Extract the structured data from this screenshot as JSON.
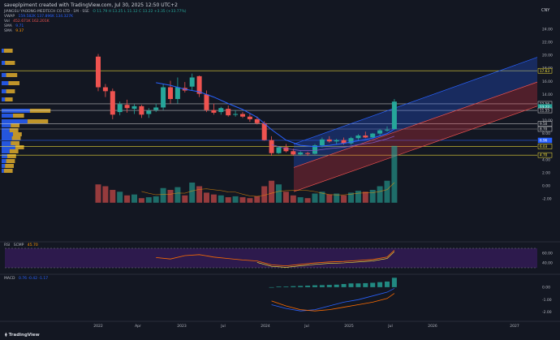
{
  "header": {
    "title": "saveplpiment created with TradingView.com, Jul 30, 2025 12:50 UTC+2",
    "currency": "CNY"
  },
  "legend": {
    "symbol_line": "JIANGSU YAODNG-MEDTECH CO LTD · 1M · SSE",
    "ohlc": "O 11.79  H 13.25  L 11.12  C 13.22  +3.35 (+33.77%)",
    "vwap_label": "VWAP",
    "vwap_values": "159.582K  137.896K  134.327K",
    "vol_label": "Vol",
    "vol_values": "452.671K  162.201K",
    "sma1_label": "SMA",
    "sma1_value": "9.71",
    "sma2_label": "SMA",
    "sma2_value": "9.37"
  },
  "price_axis": {
    "ticks": [
      "24.00",
      "22.00",
      "20.00",
      "18.00",
      "16.00",
      "14.00",
      "12.00",
      "10.00",
      "8.00",
      "6.00",
      "4.00",
      "2.00",
      "0.00",
      "-2.00"
    ]
  },
  "price_tags": [
    {
      "label": "17.63",
      "bg": "#131722",
      "fg": "#ffeb3b",
      "border": "#ffeb3b",
      "value": 17.63
    },
    {
      "label": "12.56",
      "bg": "#131722",
      "fg": "#e0e0e0",
      "border": "#e0e0e0",
      "value": 12.56
    },
    {
      "label": "13.22",
      "bg": "#26a69a",
      "fg": "#ffffff",
      "border": "#26a69a",
      "value": 12.1
    },
    {
      "label": "11.55",
      "bg": "#131722",
      "fg": "#e0e0e0",
      "border": "#e0e0e0",
      "value": 11.55
    },
    {
      "label": "9.50",
      "bg": "#131722",
      "fg": "#e0e0e0",
      "border": "#e0e0e0",
      "value": 9.5
    },
    {
      "label": "8.70",
      "bg": "#131722",
      "fg": "#e0e0e0",
      "border": "#e0e0e0",
      "value": 8.7
    },
    {
      "label": "6.96",
      "bg": "#2962ff",
      "fg": "#ffffff",
      "border": "#2962ff",
      "value": 6.96
    },
    {
      "label": "6.03",
      "bg": "#131722",
      "fg": "#ffeb3b",
      "border": "#ffeb3b",
      "value": 6.03
    },
    {
      "label": "4.70",
      "bg": "#131722",
      "fg": "#ffeb3b",
      "border": "#ffeb3b",
      "value": 4.7
    }
  ],
  "rsi": {
    "label": "RSI",
    "params": "SCMP",
    "value": "45.70",
    "ticks": [
      "60.00",
      "40.00"
    ]
  },
  "macd": {
    "label": "MACD",
    "values": "0.76  -0.42  -1.17",
    "ticks": [
      "0.00",
      "-1.00",
      "-2.00"
    ]
  },
  "time_axis": {
    "ticks": [
      "2022",
      "Apr",
      "2023",
      "Jul",
      "2024",
      "Jul",
      "2025",
      "Jul",
      "2026",
      "2027"
    ]
  },
  "brand": "TradingView",
  "colors": {
    "up": "#26a69a",
    "down": "#ef5350",
    "background": "#131722",
    "sma_blue": "#2962ff",
    "channel_blue": "#2962ff",
    "channel_red": "#f23645",
    "rsi_bg": "#311b52",
    "rsi_line": "#ff6d00",
    "vp_blue": "#2962ff",
    "vp_yellow": "#fbc02d"
  },
  "chart_data": {
    "type": "candlestick",
    "candles": [
      {
        "o": 19.8,
        "h": 20.2,
        "l": 14.5,
        "c": 15.1
      },
      {
        "o": 15.1,
        "h": 15.6,
        "l": 13.6,
        "c": 14.5
      },
      {
        "o": 14.5,
        "h": 14.9,
        "l": 10.2,
        "c": 10.9
      },
      {
        "o": 11.3,
        "h": 12.9,
        "l": 10.8,
        "c": 12.5
      },
      {
        "o": 12.4,
        "h": 13.2,
        "l": 11.2,
        "c": 11.9
      },
      {
        "o": 11.8,
        "h": 12.5,
        "l": 11.0,
        "c": 12.2
      },
      {
        "o": 12.2,
        "h": 12.4,
        "l": 10.4,
        "c": 10.9
      },
      {
        "o": 11.0,
        "h": 11.9,
        "l": 10.4,
        "c": 11.5
      },
      {
        "o": 11.6,
        "h": 12.6,
        "l": 11.3,
        "c": 12.0
      },
      {
        "o": 12.0,
        "h": 15.6,
        "l": 11.6,
        "c": 15.1
      },
      {
        "o": 15.1,
        "h": 16.1,
        "l": 12.6,
        "c": 13.3
      },
      {
        "o": 13.3,
        "h": 16.6,
        "l": 12.6,
        "c": 15.1
      },
      {
        "o": 15.0,
        "h": 15.9,
        "l": 14.3,
        "c": 14.6
      },
      {
        "o": 15.2,
        "h": 17.2,
        "l": 14.6,
        "c": 16.6
      },
      {
        "o": 16.8,
        "h": 16.9,
        "l": 13.6,
        "c": 14.1
      },
      {
        "o": 14.0,
        "h": 14.6,
        "l": 11.3,
        "c": 11.6
      },
      {
        "o": 11.6,
        "h": 12.6,
        "l": 10.9,
        "c": 11.2
      },
      {
        "o": 11.3,
        "h": 12.1,
        "l": 10.9,
        "c": 11.9
      },
      {
        "o": 11.8,
        "h": 12.3,
        "l": 10.6,
        "c": 10.8
      },
      {
        "o": 10.9,
        "h": 11.6,
        "l": 10.6,
        "c": 11.0
      },
      {
        "o": 11.0,
        "h": 11.3,
        "l": 10.4,
        "c": 10.6
      },
      {
        "o": 10.6,
        "h": 11.0,
        "l": 9.8,
        "c": 10.2
      },
      {
        "o": 10.2,
        "h": 10.6,
        "l": 9.4,
        "c": 9.6
      },
      {
        "o": 9.6,
        "h": 9.9,
        "l": 6.9,
        "c": 7.0
      },
      {
        "o": 7.0,
        "h": 7.6,
        "l": 4.6,
        "c": 5.0
      },
      {
        "o": 5.0,
        "h": 6.1,
        "l": 4.9,
        "c": 5.9
      },
      {
        "o": 5.9,
        "h": 6.4,
        "l": 5.1,
        "c": 5.3
      },
      {
        "o": 5.3,
        "h": 5.7,
        "l": 4.6,
        "c": 4.8
      },
      {
        "o": 4.8,
        "h": 5.3,
        "l": 4.6,
        "c": 5.1
      },
      {
        "o": 5.0,
        "h": 5.2,
        "l": 4.6,
        "c": 4.9
      },
      {
        "o": 4.9,
        "h": 6.4,
        "l": 4.8,
        "c": 6.2
      },
      {
        "o": 6.2,
        "h": 7.4,
        "l": 5.9,
        "c": 7.1
      },
      {
        "o": 7.1,
        "h": 7.6,
        "l": 6.6,
        "c": 6.8
      },
      {
        "o": 6.8,
        "h": 7.2,
        "l": 6.4,
        "c": 7.0
      },
      {
        "o": 7.0,
        "h": 7.4,
        "l": 6.3,
        "c": 6.5
      },
      {
        "o": 6.5,
        "h": 7.5,
        "l": 6.3,
        "c": 7.3
      },
      {
        "o": 7.3,
        "h": 7.9,
        "l": 7.0,
        "c": 7.7
      },
      {
        "o": 7.7,
        "h": 8.3,
        "l": 7.3,
        "c": 7.4
      },
      {
        "o": 7.4,
        "h": 8.1,
        "l": 7.3,
        "c": 8.0
      },
      {
        "o": 8.0,
        "h": 8.7,
        "l": 7.6,
        "c": 8.5
      },
      {
        "o": 8.5,
        "h": 9.1,
        "l": 8.3,
        "c": 8.6
      },
      {
        "o": 8.7,
        "h": 13.3,
        "l": 8.6,
        "c": 12.9
      }
    ],
    "volume": [
      20,
      18,
      14,
      12,
      8,
      9,
      5,
      6,
      7,
      16,
      14,
      17,
      8,
      22,
      18,
      11,
      9,
      8,
      6,
      7,
      6,
      5,
      7,
      18,
      24,
      20,
      12,
      8,
      6,
      5,
      10,
      12,
      9,
      10,
      8,
      11,
      13,
      12,
      14,
      18,
      24,
      62
    ],
    "ylim": [
      -3.5,
      25
    ],
    "sma_points": [
      [
        8,
        15.8
      ],
      [
        10,
        15.4
      ],
      [
        12,
        14.8
      ],
      [
        14,
        14.4
      ],
      [
        16,
        13.6
      ],
      [
        18,
        12.6
      ],
      [
        20,
        11.7
      ],
      [
        22,
        10.5
      ],
      [
        24,
        8.6
      ],
      [
        26,
        7.0
      ],
      [
        28,
        6.2
      ],
      [
        30,
        6.0
      ],
      [
        32,
        6.2
      ],
      [
        34,
        6.5
      ],
      [
        36,
        6.9
      ],
      [
        38,
        7.3
      ],
      [
        40,
        8.0
      ],
      [
        41,
        8.7
      ]
    ],
    "sma2_points": [
      [
        24,
        6.3
      ],
      [
        26,
        5.7
      ],
      [
        28,
        5.4
      ],
      [
        30,
        5.4
      ],
      [
        32,
        5.7
      ],
      [
        34,
        5.9
      ],
      [
        36,
        6.3
      ],
      [
        38,
        6.6
      ],
      [
        40,
        7.2
      ],
      [
        41,
        7.6
      ]
    ],
    "rsi_points": [
      [
        8,
        51
      ],
      [
        10,
        48
      ],
      [
        12,
        55
      ],
      [
        14,
        57
      ],
      [
        16,
        52
      ],
      [
        18,
        49
      ],
      [
        20,
        46
      ],
      [
        22,
        44
      ],
      [
        24,
        36
      ],
      [
        26,
        34
      ],
      [
        28,
        37
      ],
      [
        30,
        40
      ],
      [
        32,
        42
      ],
      [
        34,
        43
      ],
      [
        36,
        45
      ],
      [
        38,
        47
      ],
      [
        40,
        52
      ],
      [
        41,
        66
      ]
    ],
    "macd_hist": [
      0.0,
      0.05,
      0.05,
      0.08,
      0.1,
      0.12,
      0.15,
      0.16,
      0.18,
      0.2,
      0.25,
      0.3,
      0.3,
      0.32,
      0.35,
      0.4,
      0.45,
      0.75
    ],
    "macd_line": [
      [
        24,
        -1.4
      ],
      [
        26,
        -1.7
      ],
      [
        28,
        -1.9
      ],
      [
        30,
        -1.8
      ],
      [
        32,
        -1.5
      ],
      [
        34,
        -1.2
      ],
      [
        36,
        -1.0
      ],
      [
        38,
        -0.7
      ],
      [
        40,
        -0.4
      ],
      [
        41,
        -0.1
      ]
    ],
    "signal_line": [
      [
        24,
        -1.1
      ],
      [
        26,
        -1.5
      ],
      [
        28,
        -1.8
      ],
      [
        30,
        -1.9
      ],
      [
        32,
        -1.8
      ],
      [
        34,
        -1.6
      ],
      [
        36,
        -1.4
      ],
      [
        38,
        -1.2
      ],
      [
        40,
        -0.9
      ],
      [
        41,
        -0.5
      ]
    ]
  }
}
